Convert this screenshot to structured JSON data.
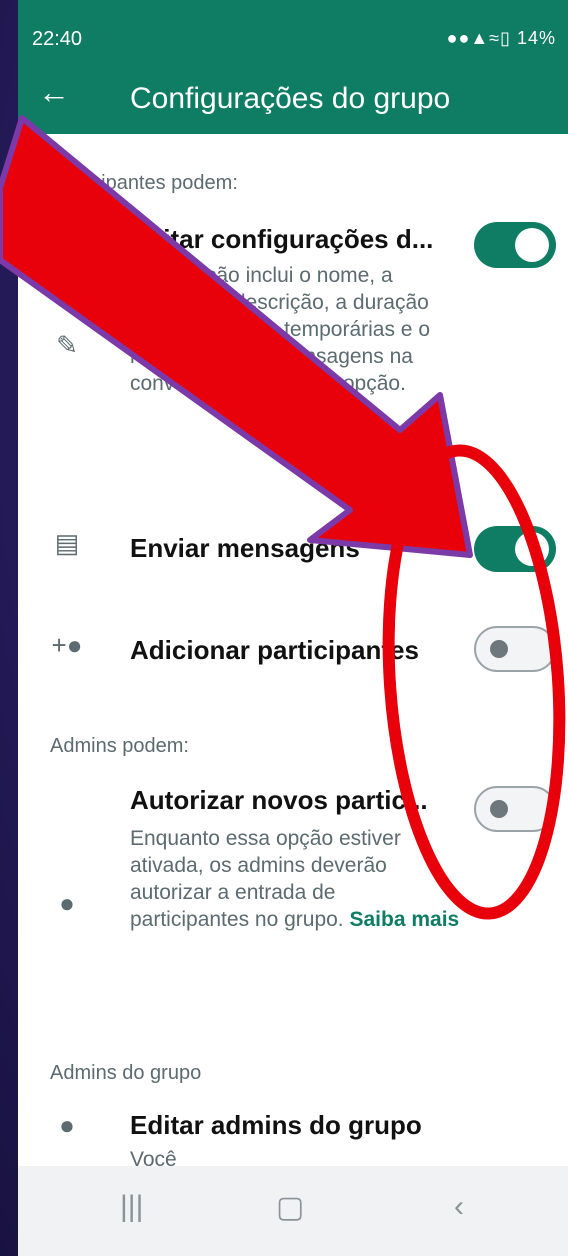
{
  "status_bar": {
    "time": "22:40",
    "battery": "14%"
  },
  "app_bar": {
    "title": "Configurações do grupo"
  },
  "sections": {
    "participants_label": "Participantes podem:",
    "admins_label": "Admins podem:",
    "group_admins_label": "Admins do grupo"
  },
  "rows": {
    "edit_settings": {
      "title": "Editar configurações d...",
      "desc": "Essa opção inclui o nome, a imagem, a descrição, a duração das mensagens temporárias e o recurso \"salvar mensagens na conversa\". Ativar essa opção."
    },
    "send_messages": {
      "title": "Enviar mensagens"
    },
    "add_participants": {
      "title": "Adicionar participantes"
    },
    "approve_new": {
      "title": "Autorizar novos partic...",
      "desc": "Enquanto essa opção estiver ativada, os admins deverão autorizar a entrada de participantes no grupo.",
      "link": "Saiba mais"
    },
    "edit_admins": {
      "title": "Editar admins do grupo",
      "subtitle": "Você"
    }
  },
  "toggles": {
    "edit_settings": "on",
    "send_messages": "on",
    "add_participants": "off",
    "approve_new": "off"
  },
  "colors": {
    "accent": "#0f7d63",
    "annotation": "#e8000b",
    "arrow_outline": "#7b3aa8"
  },
  "icons": {
    "back": "arrow-left-icon",
    "edit": "pencil-icon",
    "send": "message-icon",
    "add": "add-person-icon",
    "approve": "person-approve-icon",
    "admins": "admin-people-icon"
  }
}
